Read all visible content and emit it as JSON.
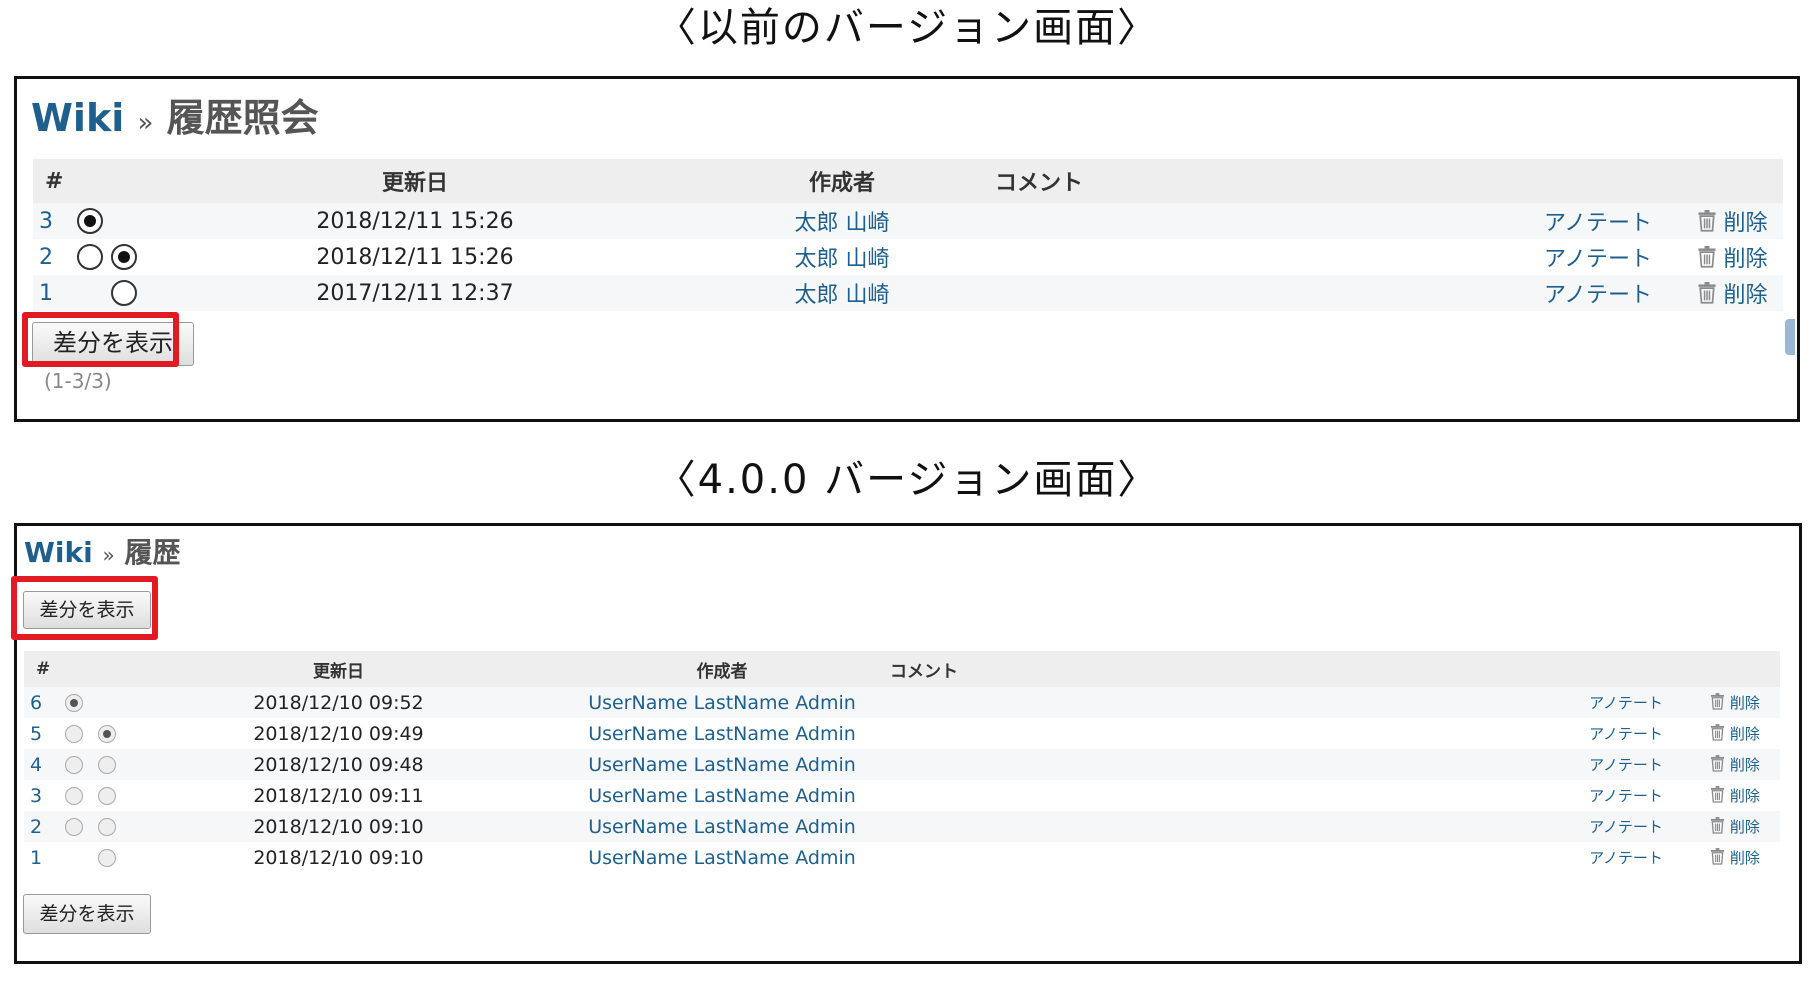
{
  "old_version": {
    "section_title": "〈以前のバージョン画面〉",
    "breadcrumb": {
      "wiki": "Wiki",
      "separator": "»",
      "page": "履歴照会"
    },
    "columns": {
      "num": "#",
      "updated": "更新日",
      "author": "作成者",
      "comment": "コメント"
    },
    "rows": [
      {
        "id": "3",
        "radio_from": "checked",
        "radio_to": "none",
        "date": "2018/12/11 15:26",
        "author": "太郎 山崎",
        "annotate": "アノテート",
        "delete": "削除"
      },
      {
        "id": "2",
        "radio_from": "unchecked",
        "radio_to": "checked",
        "date": "2018/12/11 15:26",
        "author": "太郎 山崎",
        "annotate": "アノテート",
        "delete": "削除"
      },
      {
        "id": "1",
        "radio_from": "none",
        "radio_to": "unchecked",
        "date": "2017/12/11 12:37",
        "author": "太郎 山崎",
        "annotate": "アノテート",
        "delete": "削除"
      }
    ],
    "diff_button": "差分を表示",
    "pagination": "(1-3/3)"
  },
  "new_version": {
    "section_title": "〈4.0.0 バージョン画面〉",
    "breadcrumb": {
      "wiki": "Wiki",
      "separator": "»",
      "page": "履歴"
    },
    "columns": {
      "num": "#",
      "updated": "更新日",
      "author": "作成者",
      "comment": "コメント"
    },
    "rows": [
      {
        "id": "6",
        "radio_from": "checked",
        "radio_to": "none",
        "date": "2018/12/10 09:52",
        "author": "UserName LastName Admin",
        "annotate": "アノテート",
        "delete": "削除"
      },
      {
        "id": "5",
        "radio_from": "unchecked",
        "radio_to": "checked",
        "date": "2018/12/10 09:49",
        "author": "UserName LastName Admin",
        "annotate": "アノテート",
        "delete": "削除"
      },
      {
        "id": "4",
        "radio_from": "unchecked",
        "radio_to": "unchecked",
        "date": "2018/12/10 09:48",
        "author": "UserName LastName Admin",
        "annotate": "アノテート",
        "delete": "削除"
      },
      {
        "id": "3",
        "radio_from": "unchecked",
        "radio_to": "unchecked",
        "date": "2018/12/10 09:11",
        "author": "UserName LastName Admin",
        "annotate": "アノテート",
        "delete": "削除"
      },
      {
        "id": "2",
        "radio_from": "unchecked",
        "radio_to": "unchecked",
        "date": "2018/12/10 09:10",
        "author": "UserName LastName Admin",
        "annotate": "アノテート",
        "delete": "削除"
      },
      {
        "id": "1",
        "radio_from": "none",
        "radio_to": "unchecked",
        "date": "2018/12/10 09:10",
        "author": "UserName LastName Admin",
        "annotate": "アノテート",
        "delete": "削除"
      }
    ],
    "diff_button_top": "差分を表示",
    "diff_button_bottom": "差分を表示"
  },
  "colors": {
    "link": "#1f5f8b",
    "highlight": "#e01b24",
    "header_bg": "#eeeeee"
  }
}
